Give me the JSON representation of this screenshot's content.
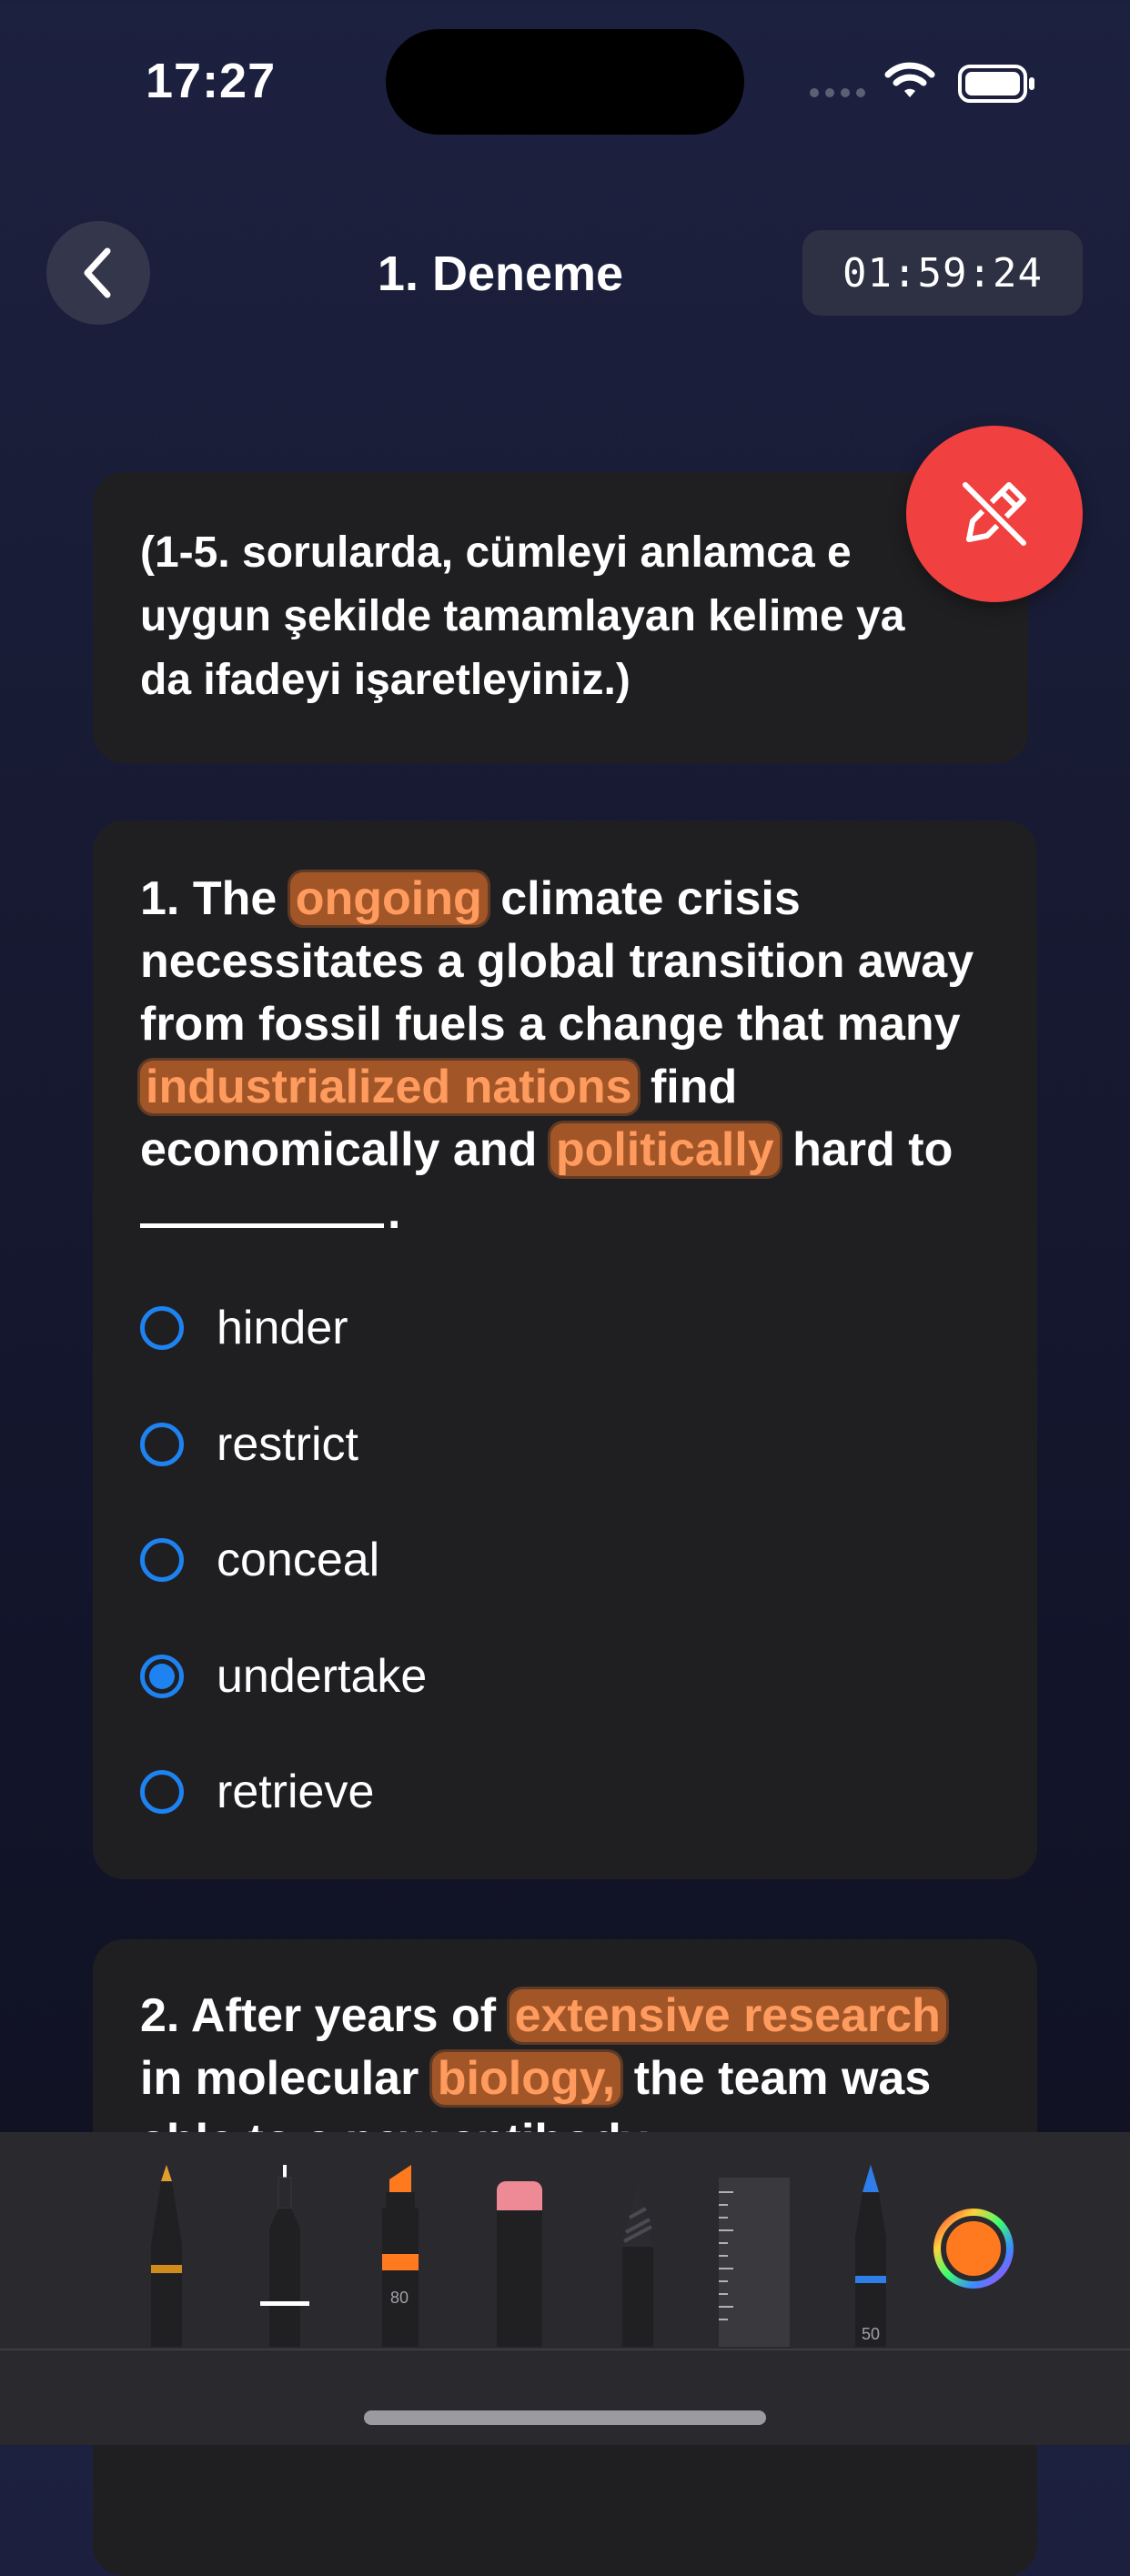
{
  "status_bar": {
    "time": "17:27"
  },
  "nav": {
    "title": "1. Deneme",
    "timer": "01:59:24"
  },
  "instructions": {
    "lines": [
      "(1-5. sorularda, cümleyi anlamca e",
      "uygun şekilde tamamlayan kelime ya",
      "da ifadeyi işaretleyiniz.)"
    ]
  },
  "question1": {
    "number_prefix": "1. The",
    "hl_ongoing": "ongoing",
    "after_ongoing": "climate crisis",
    "line2": "necessitates a global transition away",
    "line3": "from fossil fuels a change that many",
    "hl_nations": "industrialized nations",
    "after_nations": "find",
    "before_politically": "economically and",
    "hl_politically": "politically",
    "after_politically": "hard to",
    "blank_end": ".",
    "options": [
      {
        "label": "hinder",
        "selected": false
      },
      {
        "label": "restrict",
        "selected": false
      },
      {
        "label": "conceal",
        "selected": false
      },
      {
        "label": "undertake",
        "selected": true
      },
      {
        "label": "retrieve",
        "selected": false
      }
    ]
  },
  "question2": {
    "prefix": "2. After years of",
    "hl_research": "extensive research",
    "before_biology": "in molecular",
    "hl_biology": "biology,",
    "after_biology": "the team was",
    "line3_partial": "able to                    a new antibody"
  },
  "toolbar": {
    "marker_width": "80",
    "pen_width": "50",
    "tools": [
      "pen-tool",
      "fineliner-tool",
      "marker-tool",
      "eraser-tool",
      "pencil-tool",
      "ruler-tool",
      "crayon-tool",
      "color-picker"
    ],
    "colors": {
      "accent": "#1e82f0",
      "highlight": "#d66c2b",
      "fab": "#f04040",
      "selected_color": "#ff7a1f"
    }
  }
}
